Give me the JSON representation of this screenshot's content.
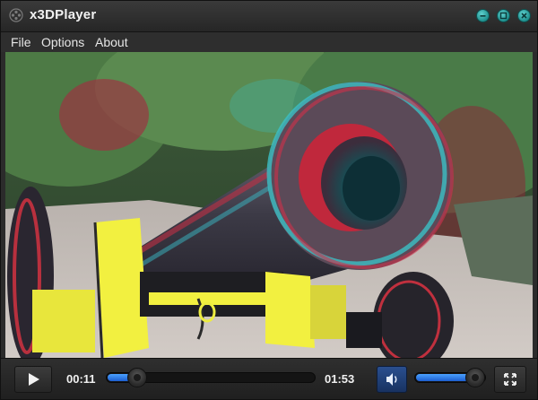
{
  "app": {
    "title": "x3DPlayer",
    "icon": "reel-icon"
  },
  "window_buttons": [
    {
      "name": "minimize",
      "icon": "minimize-icon"
    },
    {
      "name": "restore",
      "icon": "restore-icon"
    },
    {
      "name": "close",
      "icon": "close-icon"
    }
  ],
  "menu": {
    "items": [
      {
        "label": "File"
      },
      {
        "label": "Options"
      },
      {
        "label": "About"
      }
    ]
  },
  "video": {
    "description_icon": "video-frame"
  },
  "controls": {
    "play_icon": "play-icon",
    "current_time": "00:11",
    "total_time": "01:53",
    "progress_fraction": 0.097,
    "volume_icon": "speaker-icon",
    "volume_fraction": 0.88,
    "fullscreen_icon": "fullscreen-icon"
  },
  "colors": {
    "accent": "#2e7cf0",
    "window_button": "#2fa8a6",
    "titlebar": "#2f2f2f"
  }
}
